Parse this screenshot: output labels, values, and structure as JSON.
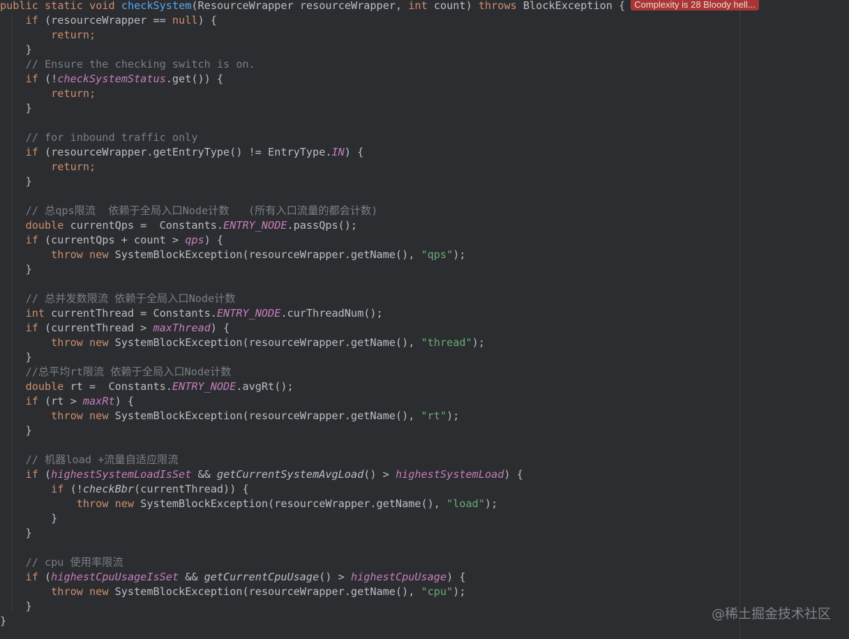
{
  "complexity_badge": "Complexity is 28 Bloody hell...",
  "watermark": "@稀土掘金技术社区",
  "code": {
    "l1": {
      "public": "public",
      "static": "static",
      "void": "void",
      "method": "checkSystem",
      "params_a": "(ResourceWrapper resourceWrapper, ",
      "int": "int",
      "params_b": " count) ",
      "throws": "throws",
      "rest": " BlockException {"
    },
    "l2": {
      "if": "if",
      "rest": " (resourceWrapper == ",
      "null": "null",
      "end": ") {"
    },
    "l3": {
      "return": "return",
      "end": ";"
    },
    "l4": {
      "text": "}"
    },
    "l5": {
      "comment": "// Ensure the checking switch is on."
    },
    "l6": {
      "if": "if",
      "a": " (!",
      "field": "checkSystemStatus",
      "b": ".get()) {"
    },
    "l7": {
      "return": "return",
      "end": ";"
    },
    "l8": {
      "text": "}"
    },
    "l10": {
      "comment": "// for inbound traffic only"
    },
    "l11": {
      "if": "if",
      "a": " (resourceWrapper.getEntryType() != EntryType.",
      "field": "IN",
      "b": ") {"
    },
    "l12": {
      "return": "return",
      "end": ";"
    },
    "l13": {
      "text": "}"
    },
    "l15": {
      "comment": "// 总qps限流  依赖于全局入口Node计数   (所有入口流量的都会计数)"
    },
    "l16": {
      "type": "double",
      "a": " currentQps =  Constants.",
      "field": "ENTRY_NODE",
      "b": ".passQps();"
    },
    "l17": {
      "if": "if",
      "a": " (currentQps + count > ",
      "field": "qps",
      "b": ") {"
    },
    "l18": {
      "throw": "throw",
      "new": "new",
      "a": " SystemBlockException(resourceWrapper.getName(), ",
      "str": "\"qps\"",
      "b": ");"
    },
    "l19": {
      "text": "}"
    },
    "l21": {
      "comment": "// 总并发数限流 依赖于全局入口Node计数"
    },
    "l22": {
      "type": "int",
      "a": " currentThread = Constants.",
      "field": "ENTRY_NODE",
      "b": ".curThreadNum();"
    },
    "l23": {
      "if": "if",
      "a": " (currentThread > ",
      "field": "maxThread",
      "b": ") {"
    },
    "l24": {
      "throw": "throw",
      "new": "new",
      "a": " SystemBlockException(resourceWrapper.getName(), ",
      "str": "\"thread\"",
      "b": ");"
    },
    "l25": {
      "text": "}"
    },
    "l26": {
      "comment": "//总平均rt限流 依赖于全局入口Node计数"
    },
    "l27": {
      "type": "double",
      "a": " rt =  Constants.",
      "field": "ENTRY_NODE",
      "b": ".avgRt();"
    },
    "l28": {
      "if": "if",
      "a": " (rt > ",
      "field": "maxRt",
      "b": ") {"
    },
    "l29": {
      "throw": "throw",
      "new": "new",
      "a": " SystemBlockException(resourceWrapper.getName(), ",
      "str": "\"rt\"",
      "b": ");"
    },
    "l30": {
      "text": "}"
    },
    "l32": {
      "comment": "// 机器load +流量自适应限流"
    },
    "l33": {
      "if": "if",
      "a": " (",
      "field1": "highestSystemLoadIsSet",
      "b": " && ",
      "call": "getCurrentSystemAvgLoad",
      "c": "() > ",
      "field2": "highestSystemLoad",
      "d": ") {"
    },
    "l34": {
      "if": "if",
      "a": " (!",
      "call": "checkBbr",
      "b": "(currentThread)) {"
    },
    "l35": {
      "throw": "throw",
      "new": "new",
      "a": " SystemBlockException(resourceWrapper.getName(), ",
      "str": "\"load\"",
      "b": ");"
    },
    "l36": {
      "text": "}"
    },
    "l37": {
      "text": "}"
    },
    "l39": {
      "comment": "// cpu 使用率限流"
    },
    "l40": {
      "if": "if",
      "a": " (",
      "field1": "highestCpuUsageIsSet",
      "b": " && ",
      "call": "getCurrentCpuUsage",
      "c": "() > ",
      "field2": "highestCpuUsage",
      "d": ") {"
    },
    "l41": {
      "throw": "throw",
      "new": "new",
      "a": " SystemBlockException(resourceWrapper.getName(), ",
      "str": "\"cpu\"",
      "b": ");"
    },
    "l42": {
      "text": "}"
    },
    "l43": {
      "text": "}"
    }
  }
}
